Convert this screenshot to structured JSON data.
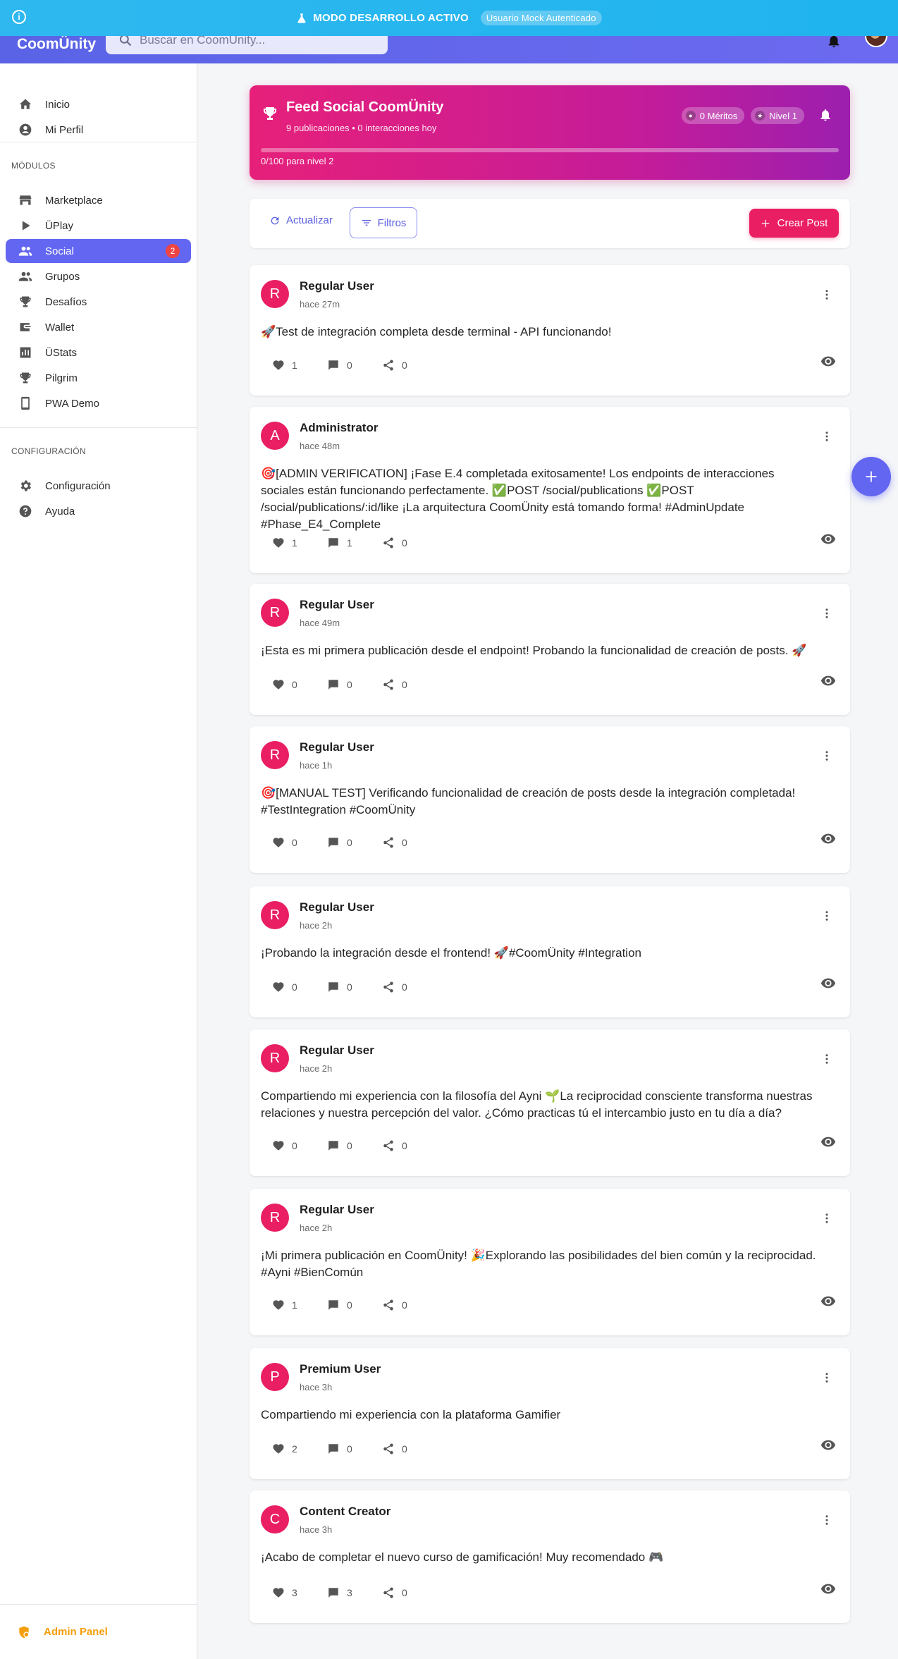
{
  "dev_banner": {
    "text": "MODO DESARROLLO ACTIVO",
    "tag": "Usuario Mock Autenticado"
  },
  "header": {
    "brand": "CoomÜnity",
    "search_placeholder": "Buscar en CoomÜnity..."
  },
  "sidebar": {
    "top_items": [
      {
        "label": "Inicio",
        "icon": "home-icon"
      },
      {
        "label": "Mi Perfil",
        "icon": "account-circle-icon"
      }
    ],
    "modules_label": "MÓDULOS",
    "modules": [
      {
        "label": "Marketplace",
        "icon": "store-icon"
      },
      {
        "label": "ÜPlay",
        "icon": "play-icon"
      },
      {
        "label": "Social",
        "icon": "people-icon",
        "badge": "2",
        "active": true
      },
      {
        "label": "Grupos",
        "icon": "groups-icon"
      },
      {
        "label": "Desafíos",
        "icon": "trophy-icon"
      },
      {
        "label": "Wallet",
        "icon": "wallet-icon"
      },
      {
        "label": "ÜStats",
        "icon": "stats-icon"
      },
      {
        "label": "Pilgrim",
        "icon": "trophy-icon"
      },
      {
        "label": "PWA Demo",
        "icon": "phone-icon"
      }
    ],
    "config_label": "CONFIGURACIÓN",
    "config": [
      {
        "label": "Configuración",
        "icon": "gear-icon"
      },
      {
        "label": "Ayuda",
        "icon": "help-icon"
      }
    ],
    "admin_label": "Admin Panel"
  },
  "hero": {
    "title": "Feed Social CoomÜnity",
    "subtitle": "9 publicaciones • 0 interacciones hoy",
    "meritos": "0 Méritos",
    "nivel": "Nivel 1",
    "progress_text": "0/100 para nivel 2",
    "progress": 0.0
  },
  "toolbar": {
    "refresh": "Actualizar",
    "filters": "Filtros",
    "create": "Crear Post"
  },
  "posts": [
    {
      "initial": "R",
      "author": "Regular User",
      "time": "hace 27m",
      "content": "🚀Test de integración completa desde terminal - API funcionando!",
      "likes": "1",
      "comments": "0",
      "shares": "0"
    },
    {
      "initial": "A",
      "author": "Administrator",
      "time": "hace 48m",
      "content": "🎯[ADMIN VERIFICATION] ¡Fase E.4 completada exitosamente! Los endpoints de interacciones sociales están funcionando perfectamente. ✅POST /social/publications ✅POST /social/publications/:id/like ¡La arquitectura CoomÜnity está tomando forma! #AdminUpdate #Phase_E4_Complete",
      "likes": "1",
      "comments": "1",
      "shares": "0"
    },
    {
      "initial": "R",
      "author": "Regular User",
      "time": "hace 49m",
      "content": "¡Esta es mi primera publicación desde el endpoint! Probando la funcionalidad de creación de posts. 🚀",
      "likes": "0",
      "comments": "0",
      "shares": "0"
    },
    {
      "initial": "R",
      "author": "Regular User",
      "time": "hace 1h",
      "content": "🎯[MANUAL TEST] Verificando funcionalidad de creación de posts desde la integración completada! #TestIntegration #CoomÜnity",
      "likes": "0",
      "comments": "0",
      "shares": "0"
    },
    {
      "initial": "R",
      "author": "Regular User",
      "time": "hace 2h",
      "content": "¡Probando la integración desde el frontend! 🚀#CoomÜnity #Integration",
      "likes": "0",
      "comments": "0",
      "shares": "0"
    },
    {
      "initial": "R",
      "author": "Regular User",
      "time": "hace 2h",
      "content": "Compartiendo mi experiencia con la filosofía del Ayni 🌱La reciprocidad consciente transforma nuestras relaciones y nuestra percepción del valor. ¿Cómo practicas tú el intercambio justo en tu día a día?",
      "likes": "0",
      "comments": "0",
      "shares": "0"
    },
    {
      "initial": "R",
      "author": "Regular User",
      "time": "hace 2h",
      "content": "¡Mi primera publicación en CoomÜnity! 🎉Explorando las posibilidades del bien común y la reciprocidad. #Ayni #BienComún",
      "likes": "1",
      "comments": "0",
      "shares": "0"
    },
    {
      "initial": "P",
      "author": "Premium User",
      "time": "hace 3h",
      "content": "Compartiendo mi experiencia con la plataforma Gamifier",
      "likes": "2",
      "comments": "0",
      "shares": "0"
    },
    {
      "initial": "C",
      "author": "Content Creator",
      "time": "hace 3h",
      "content": "¡Acabo de completar el nuevo curso de gamificación! Muy recomendado 🎮",
      "likes": "3",
      "comments": "3",
      "shares": "0"
    }
  ]
}
